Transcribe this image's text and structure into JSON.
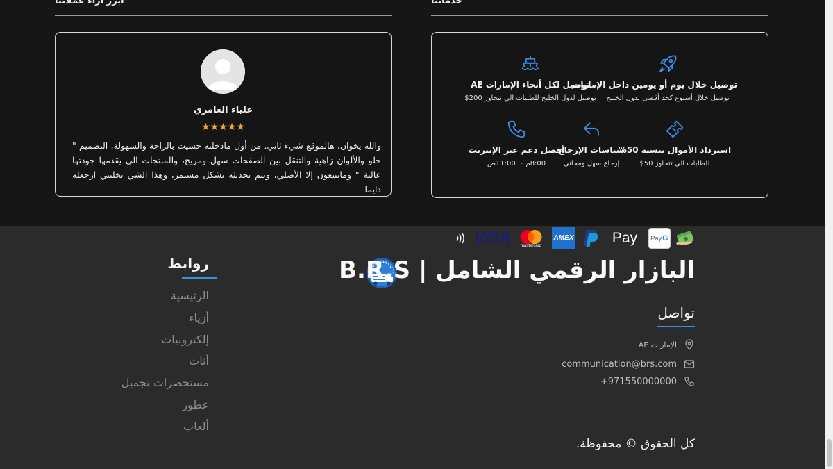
{
  "reviews": {
    "section_title": "ابرز اراء عملائنا",
    "reviewer_name": "علياء العامري",
    "stars": "★★★★★",
    "rating": 5,
    "text": "والله يخوان، هالموقع شيء ثاني. من أول مادخلته حسيت بالراحة والسهولة، التصميم \" حلو والألوان زاهية والتنقل بين الصفحات سهل ومريح، والمنتجات الي يقدمها جودتها عالية \" ومايبيعون إلا الأصلي، ويتم تحديثه بشكل مستمر، وهذا الشي يخليني ارجعله دايما"
  },
  "services": {
    "section_title": "خدماتنا",
    "items": [
      {
        "icon": "rocket-icon",
        "title": "توصيل خلال يوم أو يومين داخل الإمارات",
        "subtitle": "توصيل خلال أسبوع كحد أقصى لدول الخليج"
      },
      {
        "icon": "ship-icon",
        "title": "توصيل لكل أنحاء الإمارات AE",
        "subtitle": "توصيل لدول الخليج للطلبات الي تتجاوز 200$"
      },
      {
        "icon": "ticket-icon",
        "title": "استرداد الأموال بنسبة 50%",
        "subtitle": "للطلبات الي تتجاوز 50$"
      },
      {
        "icon": "return-arrow-icon",
        "title": "سياسات الإرجاع",
        "subtitle": "إرجاع سهل ومجاني"
      },
      {
        "icon": "phone-icon",
        "title": "أفضل دعم عبر الإنترنت",
        "subtitle": "8:00م ~ 11:00ص"
      }
    ]
  },
  "footer": {
    "brand": "البازار الرقمي الشامل | B.R.S",
    "contact_title": "تواصل",
    "location": "الإمارات AE",
    "email": "communication@brs.com",
    "phone": "+971550000000",
    "links_title": "روابط",
    "links": [
      "الرئيسية",
      "أزياء",
      "إلكترونيات",
      "أثاث",
      "مستحضرات تجميل",
      "عطور",
      "ألعاب"
    ],
    "payments": [
      "cash-icon",
      "Pay",
      "Pay",
      "PayPal",
      "AMEX",
      "mastercard",
      "VISA",
      "contactless-icon"
    ],
    "copyright": "كل الحقوق © محفوظة."
  },
  "colors": {
    "accent": "#3b8fe0",
    "star": "#f0a436",
    "footer_bg": "#2b2b2b",
    "page_bg": "#161616"
  }
}
